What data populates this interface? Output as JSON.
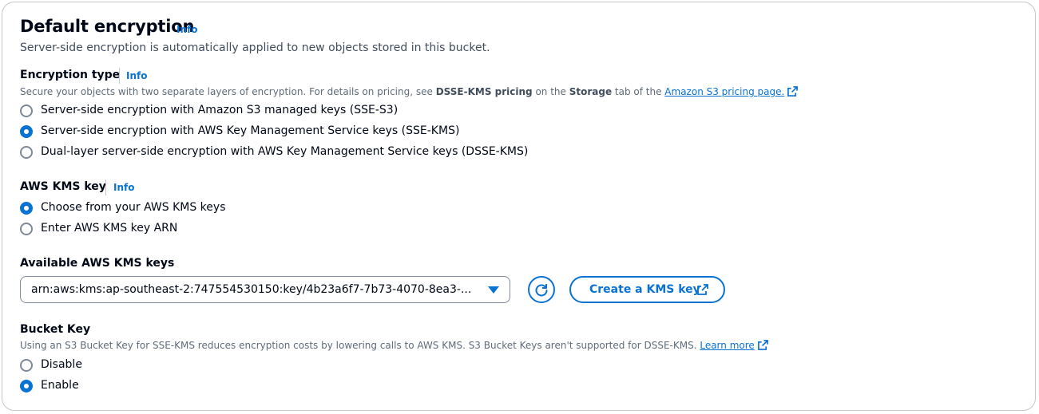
{
  "section": {
    "title": "Default encryption",
    "info": "Info",
    "description": "Server-side encryption is automatically applied to new objects stored in this bucket."
  },
  "encryption_type": {
    "label": "Encryption type",
    "info": "Info",
    "desc_prefix": "Secure your objects with two separate layers of encryption. For details on pricing, see ",
    "desc_bold1": "DSSE-KMS pricing",
    "desc_mid": " on the ",
    "desc_bold2": "Storage",
    "desc_mid2": " tab of the ",
    "desc_link": "Amazon S3 pricing page.",
    "options": [
      {
        "label": "Server-side encryption with Amazon S3 managed keys (SSE-S3)",
        "checked": false
      },
      {
        "label": "Server-side encryption with AWS Key Management Service keys (SSE-KMS)",
        "checked": true
      },
      {
        "label": "Dual-layer server-side encryption with AWS Key Management Service keys (DSSE-KMS)",
        "checked": false
      }
    ]
  },
  "kms_key": {
    "label": "AWS KMS key",
    "info": "Info",
    "options": [
      {
        "label": "Choose from your AWS KMS keys",
        "checked": true
      },
      {
        "label": "Enter AWS KMS key ARN",
        "checked": false
      }
    ]
  },
  "available_keys": {
    "label": "Available AWS KMS keys",
    "selected": "arn:aws:kms:ap-southeast-2:747554530150:key/4b23a6f7-7b73-4070-8ea3-...",
    "create_button": "Create a KMS key"
  },
  "bucket_key": {
    "label": "Bucket Key",
    "description": "Using an S3 Bucket Key for SSE-KMS reduces encryption costs by lowering calls to AWS KMS. S3 Bucket Keys aren't supported for DSSE-KMS.",
    "learn_more": "Learn more",
    "options": [
      {
        "label": "Disable",
        "checked": false
      },
      {
        "label": "Enable",
        "checked": true
      }
    ]
  },
  "colors": {
    "accent": "#0972d3",
    "text": "#000716",
    "muted": "#5f6b7a",
    "border": "#c6c6cd"
  }
}
